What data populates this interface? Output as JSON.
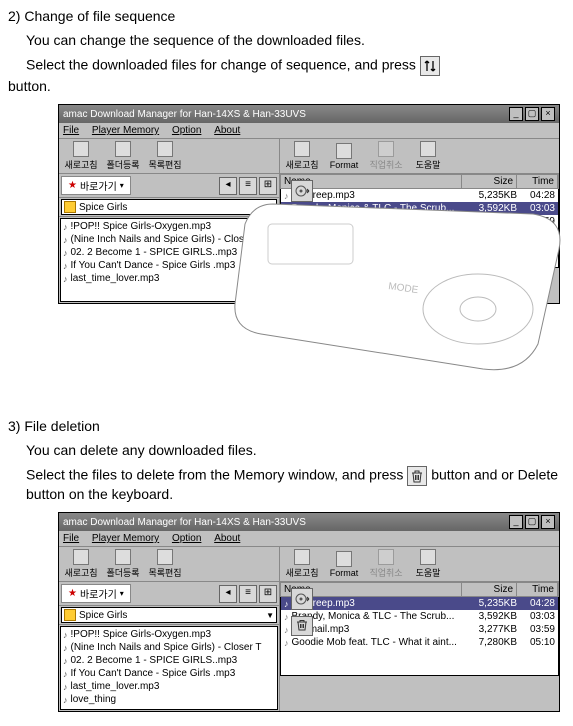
{
  "section1": {
    "title": "2) Change of file sequence",
    "p1": "You can change the sequence of the downloaded files.",
    "p2a": "Select the downloaded files for change of sequence, and press ",
    "p2b": " button."
  },
  "section2": {
    "title": "3) File deletion",
    "p1": "You can delete any downloaded files.",
    "p2a": "Select the files to delete from the Memory window, and press ",
    "p2b": " button and or Delete button on the keyboard."
  },
  "app": {
    "title": "amac Download Manager for Han-14XS & Han-33UVS",
    "menus": [
      "File",
      "Player Memory",
      "Option",
      "About"
    ],
    "left_toolbar": [
      "새로고침",
      "폴더등록",
      "목록편집"
    ],
    "right_toolbar": [
      {
        "label": "새로고침",
        "faded": false
      },
      {
        "label": "Format",
        "faded": false
      },
      {
        "label": "직업취소",
        "faded": true
      },
      {
        "label": "도움말",
        "faded": false
      }
    ],
    "loc_label": "바로가기",
    "left_dropdown": "Spice Girls",
    "left_files": [
      "!POP!! Spice Girls-Oxygen.mp3",
      "(Nine Inch Nails and Spice Girls) - Closer T",
      "02. 2 Become 1 - SPICE GIRLS..mp3",
      "If You Can't Dance - Spice Girls .mp3",
      "last_time_lover.mp3",
      "love_thing"
    ],
    "headers": {
      "name": "Name",
      "size": "Size",
      "time": "Time"
    },
    "right_rows": [
      {
        "name": "12 Creep.mp3",
        "size": "5,235KB",
        "time": "04:28"
      },
      {
        "name": "Brandy, Monica & TLC - The Scrub...",
        "size": "3,592KB",
        "time": "03:03"
      },
      {
        "name": "Fanmail.mp3",
        "size": "3,277KB",
        "time": "03:59"
      },
      {
        "name": "Goodie Mob feat. TLC - What it aint...",
        "size": "7,280KB",
        "time": "05:10"
      }
    ]
  },
  "fig1": {
    "selected_row_index": 1,
    "left_files_visible": 5
  },
  "fig2": {
    "selected_row_index": 0,
    "left_files_visible": 6
  }
}
